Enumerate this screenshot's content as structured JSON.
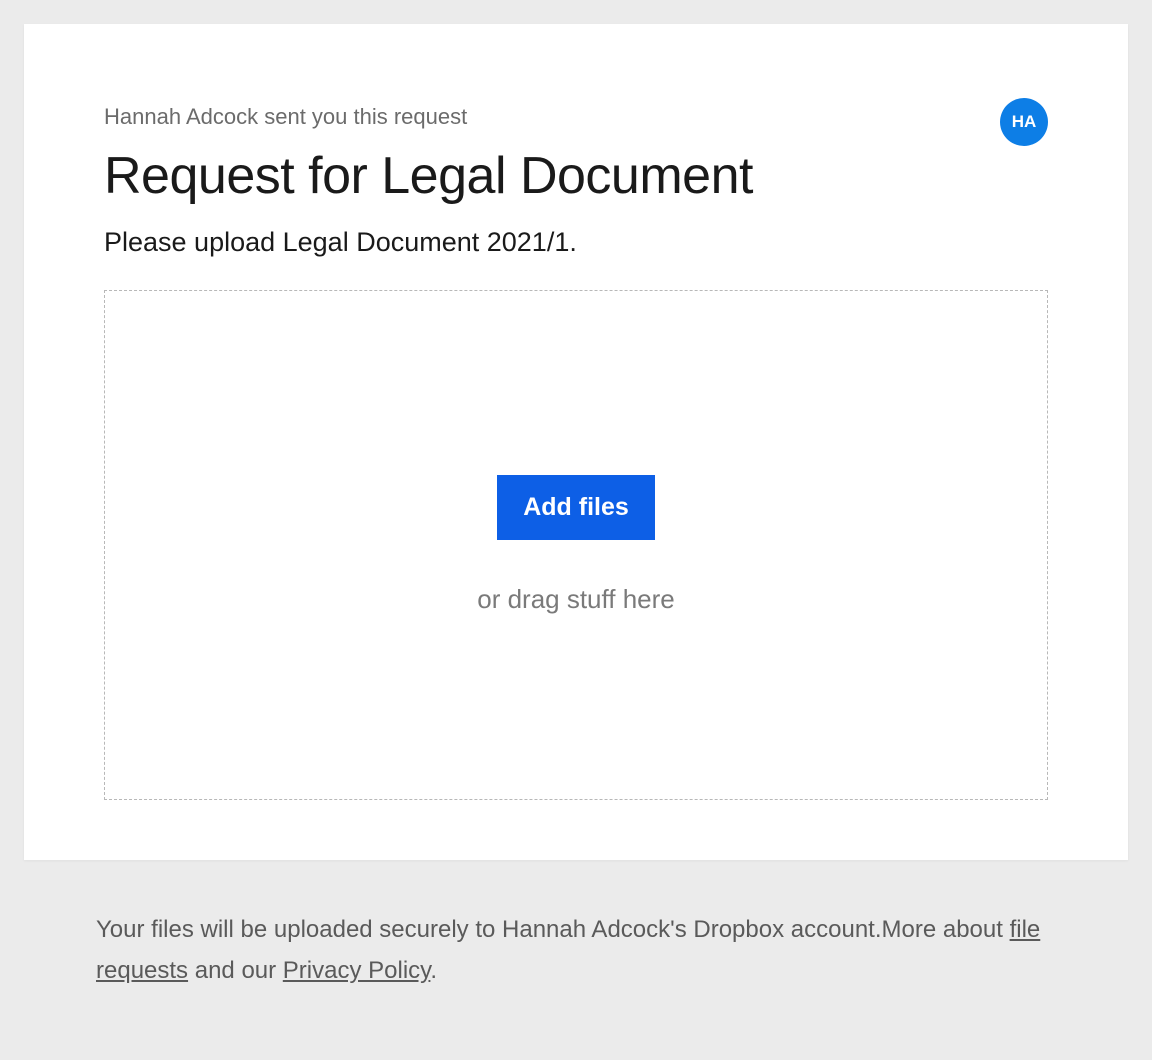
{
  "sender": {
    "line": "Hannah Adcock sent you this request",
    "initials": "HA"
  },
  "title": "Request for Legal Document",
  "subtitle": "Please upload Legal Document 2021/1.",
  "dropzone": {
    "button_label": "Add files",
    "hint": "or drag stuff here"
  },
  "footer": {
    "text_before": "Your files will be uploaded securely to Hannah Adcock's Dropbox account.More about ",
    "link1": "file requests",
    "text_middle": " and our ",
    "link2": "Privacy Policy",
    "text_after": "."
  },
  "colors": {
    "background": "#ebebeb",
    "card": "#ffffff",
    "button": "#0d5fe6",
    "avatar": "#0d7ee6"
  }
}
